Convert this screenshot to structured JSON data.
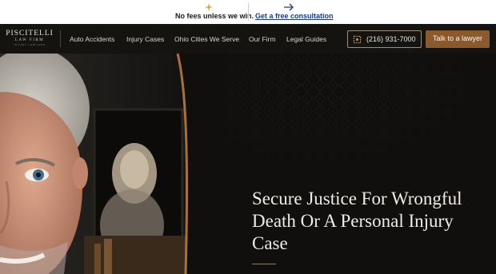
{
  "announcement": {
    "no_fees": "No fees unless we win.",
    "consult_link": "Get a free consultation"
  },
  "logo": {
    "line1": "PISCITELLI",
    "line2": "LAW FIRM",
    "line3": "INJURY LAWYERS"
  },
  "nav": {
    "items": [
      "Auto Accidents",
      "Injury Cases",
      "Ohio Cities We Serve",
      "Our Firm",
      "Legal Guides"
    ],
    "phone": "(216) 931-7000",
    "cta": "Talk to a lawyer"
  },
  "hero": {
    "headline_lines": [
      "Secure Justice For Wrongful",
      "Death Or A Personal Injury",
      "Case"
    ]
  },
  "colors": {
    "accent": "#8a5a2b",
    "background": "#0f0e0c",
    "link": "#1b3a8f"
  }
}
